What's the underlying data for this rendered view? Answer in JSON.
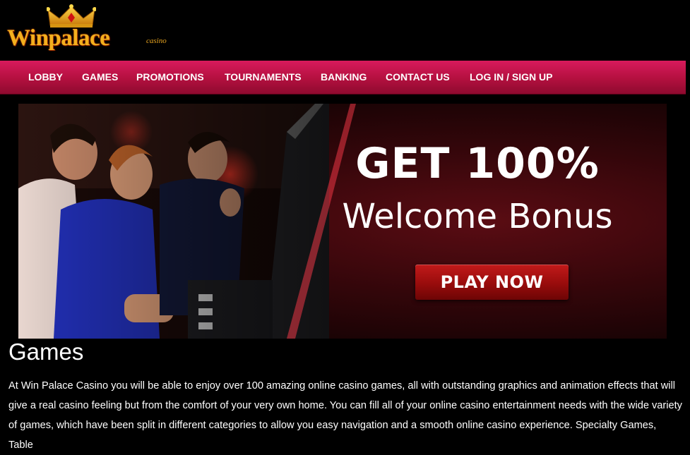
{
  "logo": {
    "name": "Winpalace",
    "sub": "casino"
  },
  "nav": {
    "items": [
      {
        "label": "LOBBY"
      },
      {
        "label": "GAMES"
      },
      {
        "label": "PROMOTIONS"
      },
      {
        "label": "TOURNAMENTS"
      },
      {
        "label": "BANKING"
      },
      {
        "label": "CONTACT US"
      },
      {
        "label": "LOG IN / SIGN UP"
      }
    ]
  },
  "banner": {
    "headline": "GET 100%",
    "subheadline": "Welcome Bonus",
    "cta": "PLAY NOW"
  },
  "content": {
    "title": "Games",
    "body": "At Win Palace Casino you will be able to enjoy over 100 amazing online casino games, all with outstanding graphics and animation effects that will give a real casino feeling but from the comfort of your very own home. You can fill all of your online casino entertainment needs with the wide variety of games, which have been split in different categories to allow you easy navigation and a smooth online casino experience. Specialty Games, Table"
  },
  "colors": {
    "nav_bg": "#c3154b",
    "logo_gold": "#f3b01e",
    "cta_red": "#a81010",
    "page_bg": "#000000"
  }
}
